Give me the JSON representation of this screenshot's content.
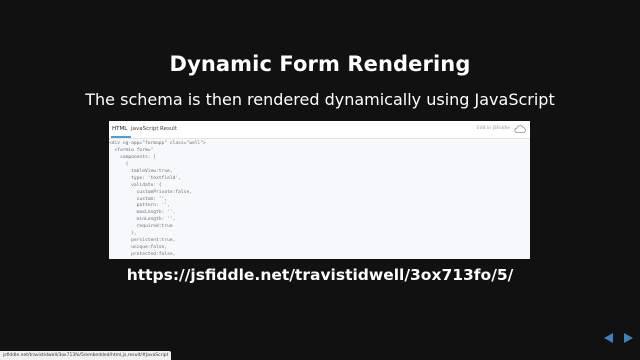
{
  "slide": {
    "title": "Dynamic Form Rendering",
    "subtitle": "The schema is then rendered dynamically using JavaScript",
    "link": "https://jsfiddle.net/travistidwell/3ox713fo/5/"
  },
  "fiddle": {
    "tabs": [
      "HTML",
      "JavaScript",
      "Result"
    ],
    "active_tab": "HTML",
    "edit_label": "Edit in JSFiddle",
    "code_lines": [
      "<div ng-app=\"formapp\" class=\"well\">",
      "  <formio form=\"",
      "    components: [",
      "      {",
      "        tableView:true,",
      "        type: 'textfield',",
      "        validate: {",
      "          customPrivate:false,",
      "          custom: '',",
      "          pattern: '',",
      "          maxLength: '',",
      "          minLength: '',",
      "          required:true",
      "        },",
      "        persistent:true,",
      "        unique:false,",
      "        protected:false,"
    ]
  },
  "status_bar": {
    "url": "jsfiddle.net/travistidwell/3ox713fo/5/embedded/html,js,result/#JavaScript"
  },
  "icons": {
    "cloud": "cloud-icon",
    "prev": "arrow-left-icon",
    "next": "arrow-right-icon"
  },
  "colors": {
    "background": "#111111",
    "nav_arrows": "#3b82c4",
    "tab_accent": "#49a0d8"
  }
}
